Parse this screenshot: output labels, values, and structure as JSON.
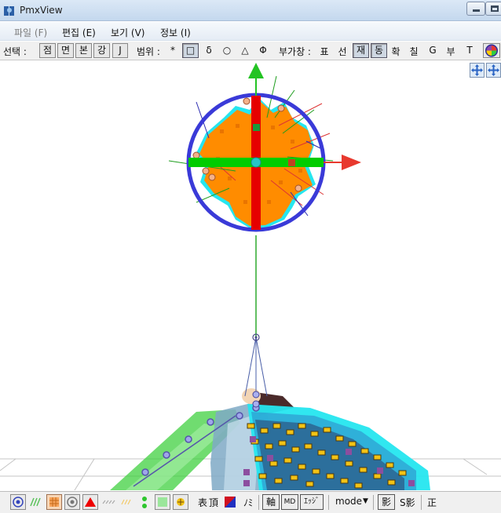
{
  "window": {
    "title": "PmxView"
  },
  "menu": [
    {
      "label": "파일 (F)",
      "disabled": true
    },
    {
      "label": "편집 (E)",
      "disabled": false
    },
    {
      "label": "보기 (V)",
      "disabled": false
    },
    {
      "label": "정보 (I)",
      "disabled": false
    }
  ],
  "toolbar": {
    "select_label": "선택 :",
    "select_buttons": [
      "점",
      "면",
      "본",
      "강",
      "J"
    ],
    "range_label": "범위 :",
    "range_items": [
      "*",
      "□",
      "δ",
      "○",
      "△",
      "Φ"
    ],
    "subwin_label": "부가창 :",
    "subwin_items": [
      "표",
      "선",
      "재",
      "동",
      "확",
      "칠",
      "G",
      "부",
      "T"
    ],
    "subwin_pressed": [
      "재",
      "동"
    ]
  },
  "bottom": {
    "text_items": [
      "表",
      "頂",
      "ﾉﾐ"
    ],
    "axis_button": "軸",
    "md_button": "MD",
    "edge_button": "ｴｯｼﾞ",
    "mode_dropdown": "mode",
    "shadow_button": "影",
    "sshadow_label": "S影",
    "sei_label": "正"
  },
  "colors": {
    "gizmo_ring": "#3a3ad8",
    "axis_x": "#00cc00",
    "axis_y": "#e60000",
    "arrow_x": "#e8392e",
    "arrow_y": "#23c323",
    "mesh_orange": "#ff8c00",
    "mesh_cyan": "#25e6ef"
  }
}
